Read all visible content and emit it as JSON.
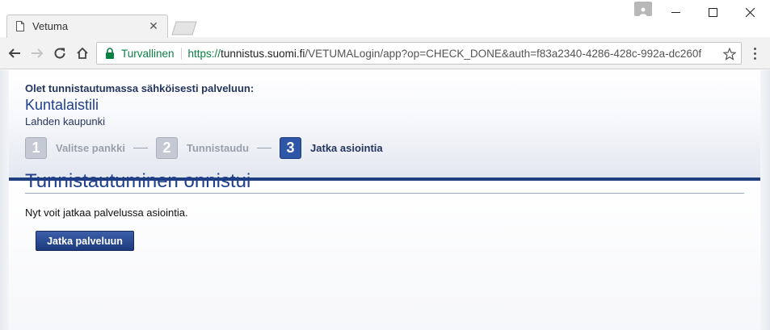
{
  "browser": {
    "tab_title": "Vetuma",
    "tab_close_glyph": "✕",
    "secure_label": "Turvallinen",
    "url_scheme": "https://",
    "url_host": "tunnistus.suomi.fi",
    "url_path": "/VETUMALogin/app?op=CHECK_DONE&auth=f83a2340-4286-428c-992a-dc260f",
    "icons": {
      "back": "back-arrow-icon",
      "forward": "forward-arrow-icon",
      "reload": "reload-icon",
      "home": "home-icon",
      "lock": "lock-icon",
      "star": "star-icon",
      "menu": "more-vertical-icon"
    },
    "window_controls": {
      "minimize_glyph": "─",
      "maximize_glyph": "☐",
      "close_glyph": "✕"
    },
    "colors": {
      "secure": "#0b8043"
    }
  },
  "page": {
    "service_intro": "Olet tunnistautumassa sähköisesti palveluun:",
    "service_name": "Kuntalaistili",
    "service_org": "Lahden kaupunki",
    "steps": [
      {
        "number": "1",
        "label": "Valitse pankki",
        "state": "inactive"
      },
      {
        "number": "2",
        "label": "Tunnistaudu",
        "state": "inactive"
      },
      {
        "number": "3",
        "label": "Jatka asiointia",
        "state": "active"
      }
    ],
    "title": "Tunnistautuminen onnistui",
    "body": "Nyt voit jatkaa palvelussa asiointia.",
    "continue_button": "Jatka palveluun",
    "colors": {
      "accent": "#1f3f8f",
      "divider": "#1f3f7f",
      "active_step": "#2f56a6"
    }
  }
}
